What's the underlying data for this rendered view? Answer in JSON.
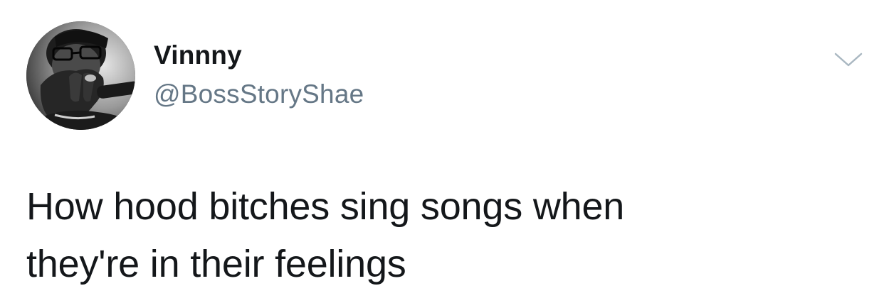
{
  "author": {
    "display_name": "Vinnny",
    "handle": "@BossStoryShae",
    "avatar_icon": "profile-photo"
  },
  "menu": {
    "icon": "chevron-down-icon",
    "color": "#aab8c2"
  },
  "tweet": {
    "lines": [
      "How hood bitches sing songs when",
      "they're in their feelings"
    ]
  },
  "colors": {
    "text": "#14171a",
    "secondary_text": "#657786",
    "background": "#ffffff"
  }
}
